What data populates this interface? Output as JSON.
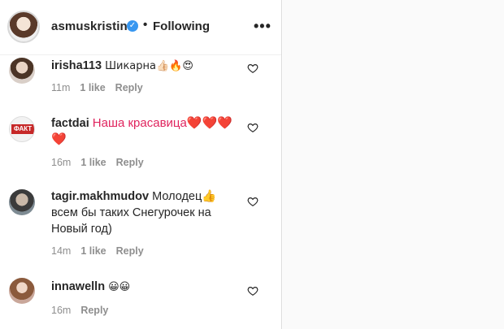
{
  "post": {
    "username": "asmuskristina",
    "verified_mark": "✓",
    "separator": "•",
    "follow_status": "Following",
    "more_label": "•••"
  },
  "comments": [
    {
      "username": "irisha113",
      "text": "Шикарна👍🏻🔥😍",
      "time": "11m",
      "likes": "1 like",
      "reply": "Reply"
    },
    {
      "username": "factdai",
      "text": "Наша красавица❤️❤️❤️ ❤️",
      "time": "16m",
      "likes": "1 like",
      "reply": "Reply"
    },
    {
      "username": "tagir.makhmudov",
      "text": "Молодец👍 всем бы таких Снегурочек на Новый год)",
      "time": "14m",
      "likes": "1 like",
      "reply": "Reply"
    },
    {
      "username": "innawelln",
      "text": "😀😀",
      "time": "16m",
      "likes": "",
      "reply": "Reply"
    }
  ],
  "avatar_labels": {
    "factdai": "ФАКТ"
  },
  "icons": {
    "like": "heart-outline-icon",
    "more": "more-options-icon",
    "verified": "verified-badge-icon"
  },
  "colors": {
    "verified": "#3897f0",
    "meta": "#8e8e8e",
    "heart_emoji": "#e0245e"
  }
}
